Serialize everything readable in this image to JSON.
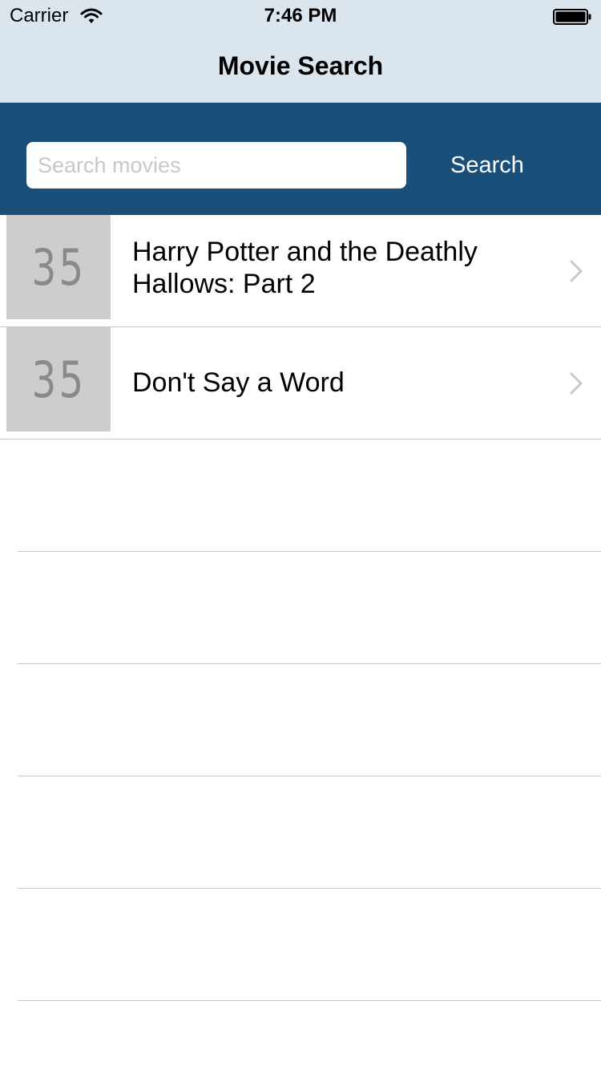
{
  "status_bar": {
    "carrier": "Carrier",
    "time": "7:46 PM"
  },
  "nav": {
    "title": "Movie Search"
  },
  "search": {
    "placeholder": "Search movies",
    "value": "",
    "button_label": "Search"
  },
  "results": [
    {
      "thumbnail_text": "35",
      "title": "Harry Potter and the Deathly Hallows: Part 2"
    },
    {
      "thumbnail_text": "35",
      "title": "Don't Say a Word"
    }
  ],
  "icons": {
    "wifi": "wifi-icon",
    "battery": "battery-icon",
    "chevron": "chevron-right-icon"
  },
  "colors": {
    "header_bg": "#dbe5ee",
    "search_bar_bg": "#1a4f7a",
    "thumbnail_bg": "#cdcdcd",
    "separator": "#c8c7cc"
  }
}
